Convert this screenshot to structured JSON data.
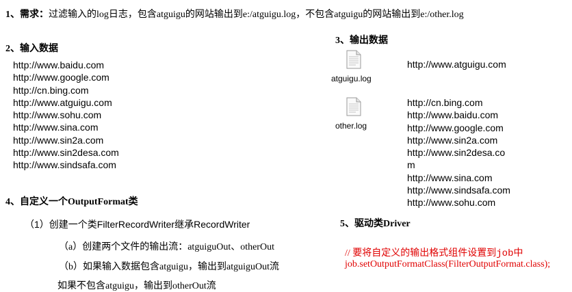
{
  "requirement": {
    "num": "1、",
    "label": "需求：",
    "text": "过滤输入的log日志，包含atguigu的网站输出到e:/atguigu.log，不包含atguigu的网站输出到e:/other.log"
  },
  "input_section": {
    "heading": "2、输入数据",
    "urls": [
      "http://www.baidu.com",
      "http://www.google.com",
      "http://cn.bing.com",
      "http://www.atguigu.com",
      "http://www.sohu.com",
      "http://www.sina.com",
      "http://www.sin2a.com",
      "http://www.sin2desa.com",
      "http://www.sindsafa.com"
    ]
  },
  "custom_section": {
    "heading_prefix": "4、自定义一个",
    "heading_class": "OutputFormat",
    "heading_suffix": "类",
    "step1": "（1）创建一个类FilterRecordWriter继承RecordWriter",
    "step_a": "（a）创建两个文件的输出流：atguiguOut、otherOut",
    "step_b": "（b）如果输入数据包含atguigu，输出到atguiguOut流",
    "step_c": "如果不包含atguigu，输出到otherOut流"
  },
  "output_section": {
    "heading": "3、输出数据",
    "files": [
      {
        "name": "atguigu.log",
        "icon": "text-file-icon",
        "urls": [
          "http://www.atguigu.com"
        ]
      },
      {
        "name": "other.log",
        "icon": "text-file-icon",
        "urls": [
          "http://cn.bing.com",
          "http://www.baidu.com",
          "http://www.google.com",
          "http://www.sin2a.com",
          "http://www.sin2desa.co",
          "m",
          "http://www.sina.com",
          "http://www.sindsafa.com",
          "http://www.sohu.com"
        ]
      }
    ]
  },
  "driver_section": {
    "heading_prefix": "5、驱动类",
    "heading_class": "Driver",
    "comment_prefix": "//  要将自定义的输出格式组件设置到",
    "comment_code": "job",
    "comment_suffix": "中",
    "code": "job.setOutputFormatClass(FilterOutputFormat.class);"
  },
  "colors": {
    "accent_red": "#e00000"
  }
}
